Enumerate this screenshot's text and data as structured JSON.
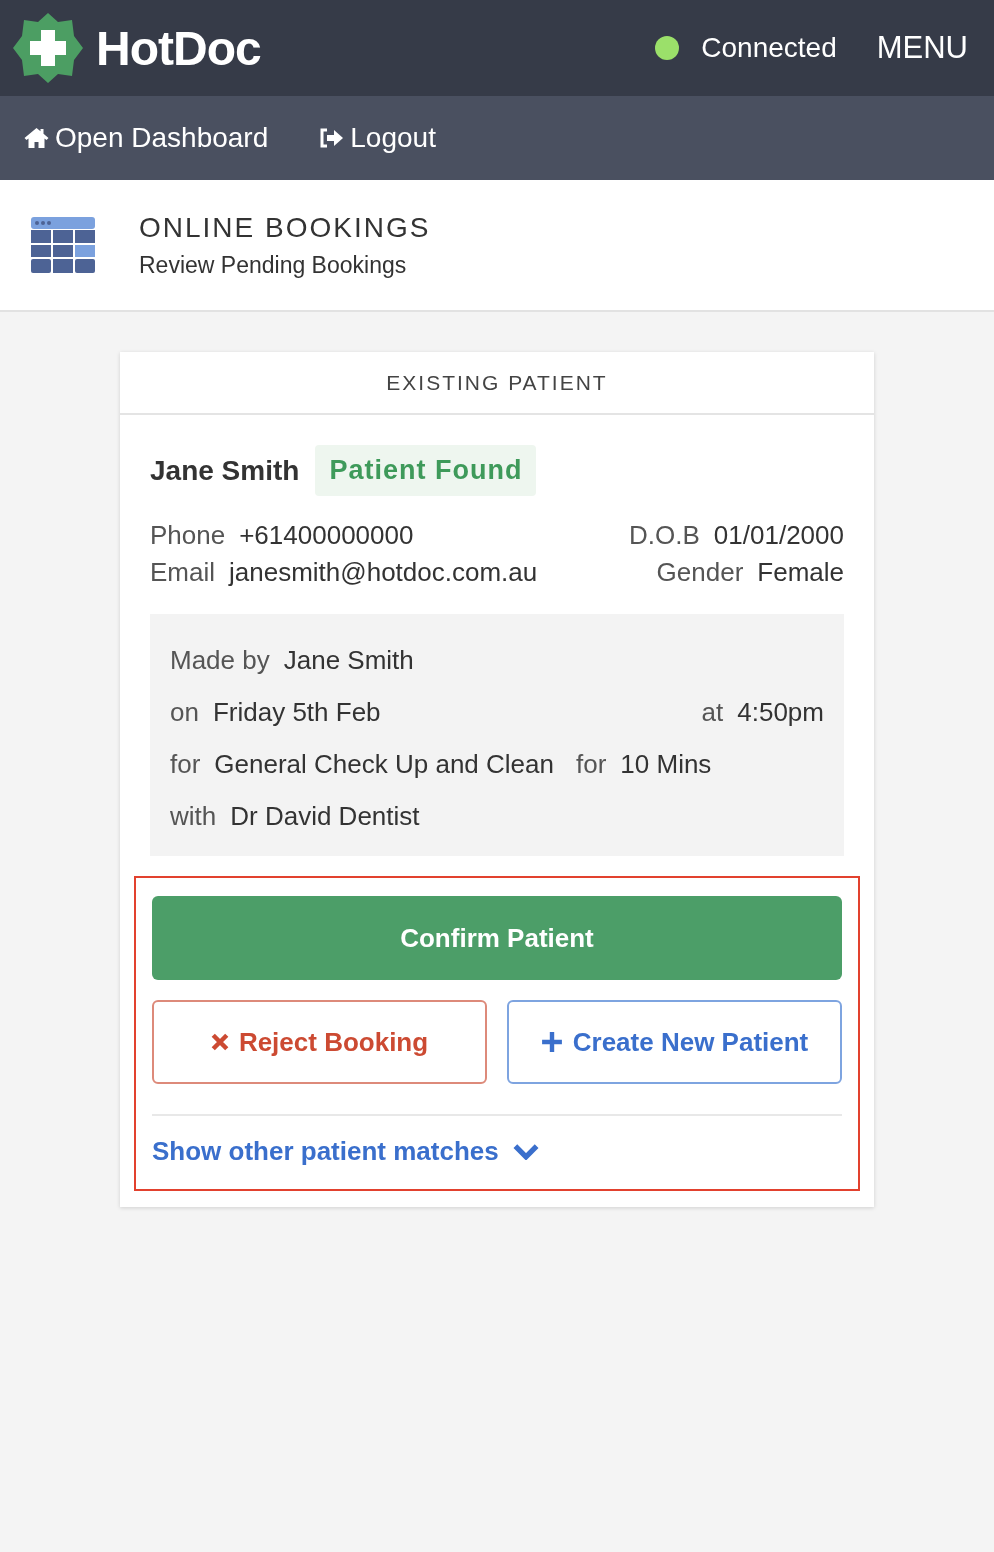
{
  "app": {
    "name": "HotDoc",
    "status": {
      "label": "Connected",
      "connected": true
    },
    "menu": "MENU"
  },
  "nav": [
    {
      "label": "Open Dashboard"
    },
    {
      "label": "Logout"
    }
  ],
  "page": {
    "title": "ONLINE BOOKINGS",
    "subtitle": "Review Pending Bookings"
  },
  "card": {
    "title": "EXISTING PATIENT",
    "patient": {
      "name": "Jane Smith",
      "badge": "Patient Found"
    },
    "fields": {
      "left": [
        {
          "label": "Phone",
          "value": "+61400000000"
        },
        {
          "label": "Email",
          "value": "janesmith@hotdoc.com.au"
        }
      ],
      "right": [
        {
          "label": "D.O.B",
          "value": "01/01/2000"
        },
        {
          "label": "Gender",
          "value": "Female"
        }
      ]
    },
    "booking": [
      {
        "parts": [
          {
            "label": "Made by",
            "value": "Jane Smith"
          }
        ]
      },
      {
        "parts": [
          {
            "label": "on",
            "value": "Friday 5th Feb"
          }
        ],
        "trailing": {
          "label": "at",
          "value": "4:50pm"
        }
      },
      {
        "parts": [
          {
            "label": "for",
            "value": "General Check Up and Clean"
          },
          {
            "label": "for",
            "value": "10 Mins"
          }
        ]
      },
      {
        "parts": [
          {
            "label": "with",
            "value": "Dr David Dentist"
          }
        ]
      }
    ],
    "actions": [
      {
        "label": "Confirm Patient",
        "kind": "primary"
      },
      {
        "label": "Reject Booking",
        "kind": "reject"
      },
      {
        "label": "Create New Patient",
        "kind": "create"
      }
    ],
    "more_link": "Show other patient matches",
    "highlighted": true
  }
}
